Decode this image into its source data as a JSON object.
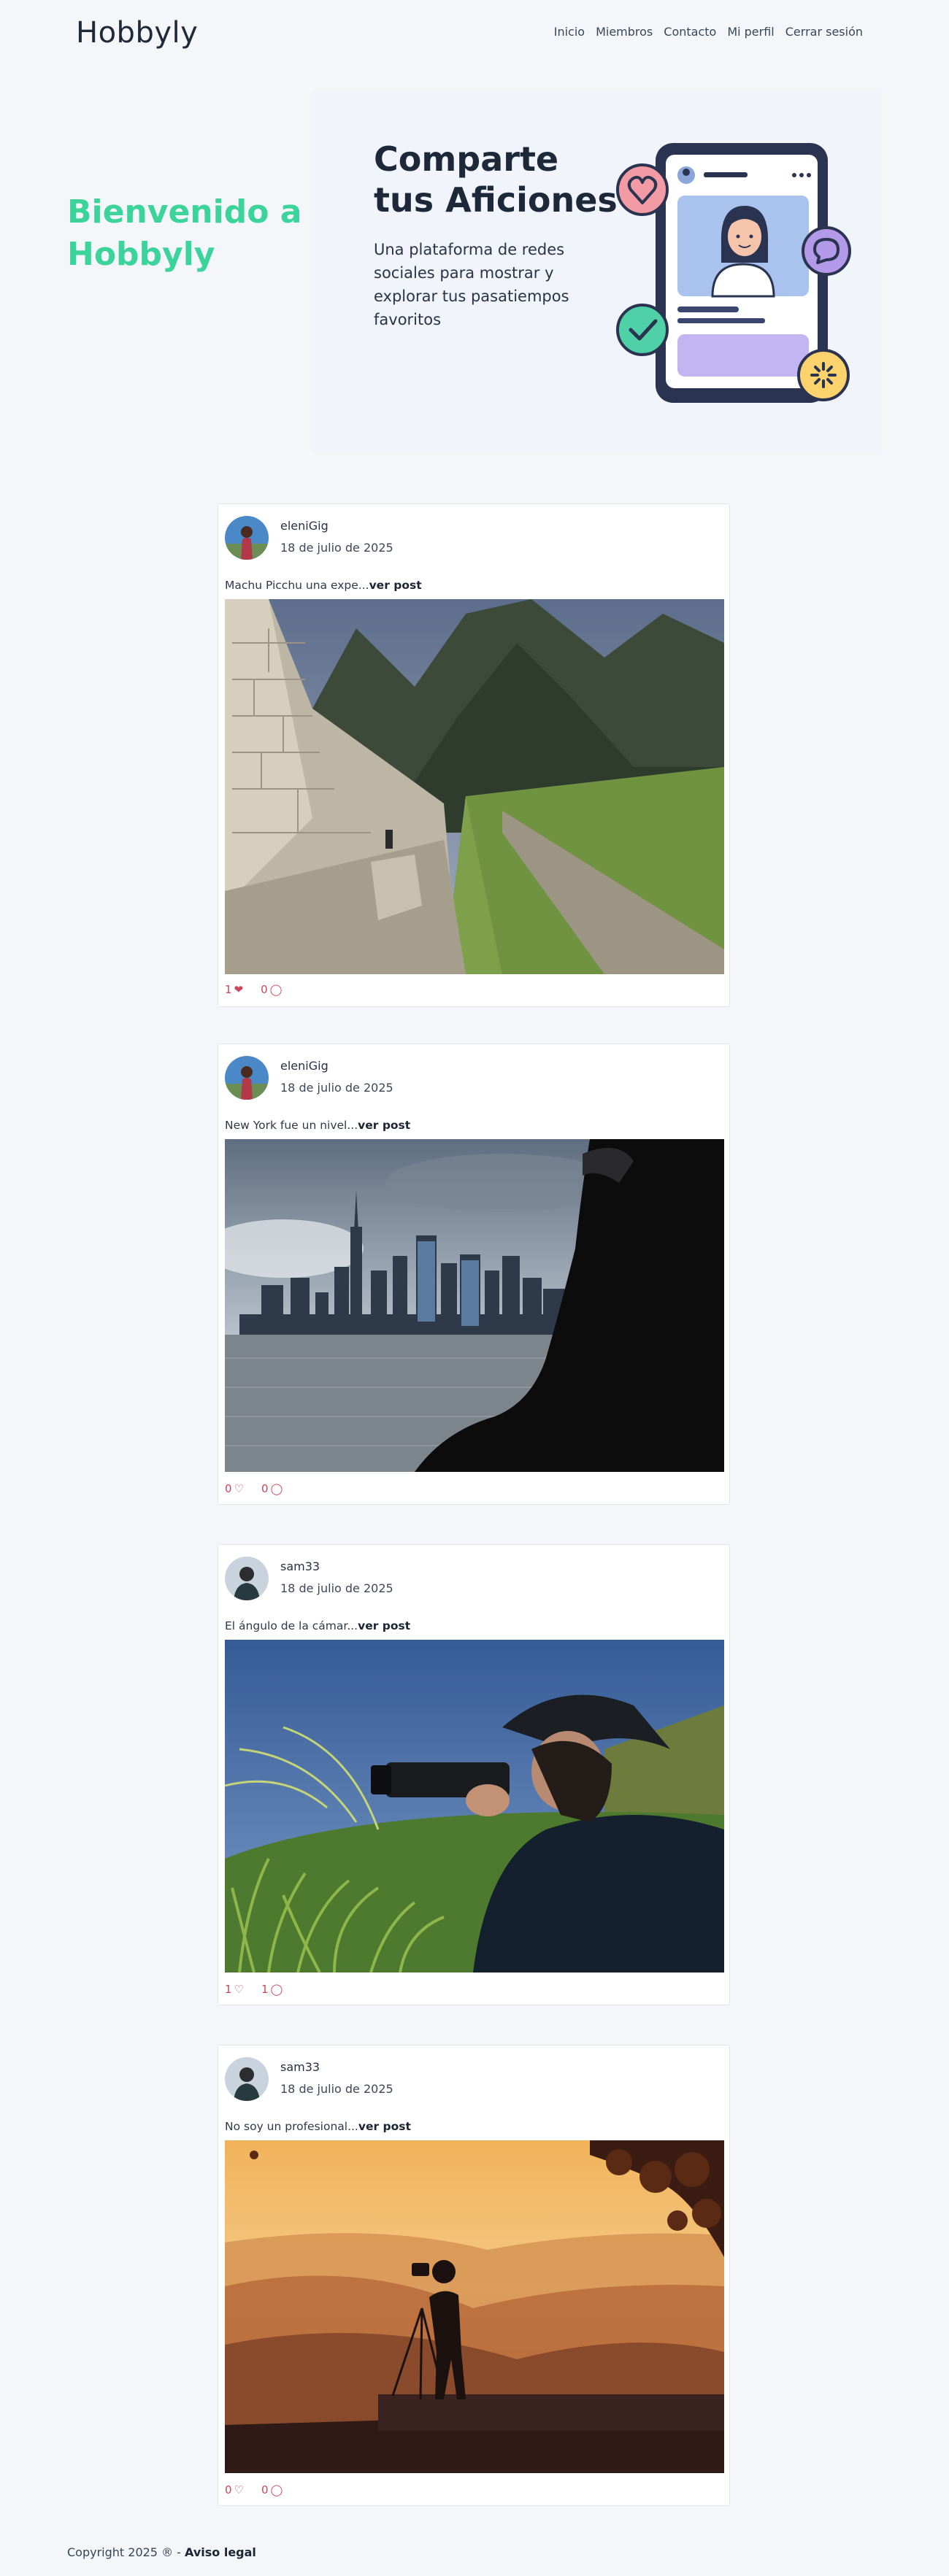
{
  "header": {
    "logo": "Hobbyly",
    "nav": [
      "Inicio",
      "Miembros",
      "Contacto",
      "Mi perfil",
      "Cerrar sesión"
    ]
  },
  "hero": {
    "welcome": "Bienvenido a Hobbyly",
    "title": "Comparte tus Aficiones",
    "subtitle": "Una plataforma de redes sociales para mostrar y explorar tus pasatiempos favoritos"
  },
  "posts": [
    {
      "author": "eleniGig",
      "date": "18 de julio de 2025",
      "caption": "Machu Picchu una expe...",
      "more": "ver post",
      "likes": "1",
      "comments": "0",
      "liked": true
    },
    {
      "author": "eleniGig",
      "date": "18 de julio de 2025",
      "caption": "New York fue un nivel...",
      "more": "ver post",
      "likes": "0",
      "comments": "0",
      "liked": false
    },
    {
      "author": "sam33",
      "date": "18 de julio de 2025",
      "caption": "El ángulo de la cámar...",
      "more": "ver post",
      "likes": "1",
      "comments": "1",
      "liked": false
    },
    {
      "author": "sam33",
      "date": "18 de julio de 2025",
      "caption": "No soy un profesional...",
      "more": "ver post",
      "likes": "0",
      "comments": "0",
      "liked": false
    }
  ],
  "footer": {
    "copyright": "Copyright 2025 ® - ",
    "legal": "Aviso legal"
  },
  "colors": {
    "accent": "#3cd49b",
    "heart": "#c8465a",
    "text": "#1d2838"
  }
}
